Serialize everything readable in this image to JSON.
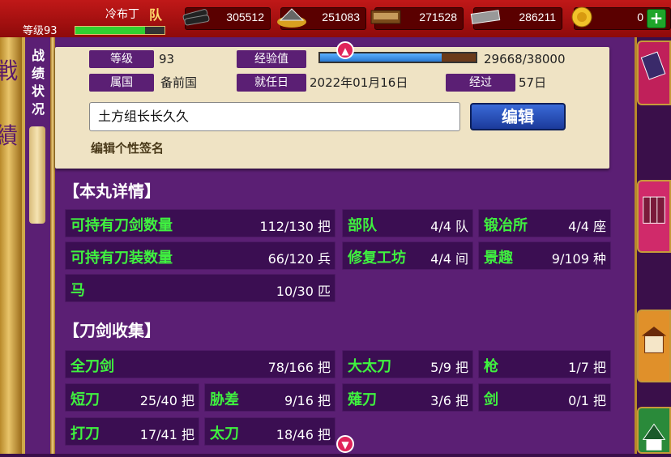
{
  "player": {
    "name": "冷布丁",
    "tag": "队",
    "level_label": "等级",
    "level": "93",
    "exp_fraction": 0.78
  },
  "resources": [
    {
      "name": "charcoal",
      "icon": "charcoal-icon",
      "value": "305512"
    },
    {
      "name": "steel",
      "icon": "steel-icon",
      "value": "251083"
    },
    {
      "name": "coolant",
      "icon": "coolant-icon",
      "value": "271528"
    },
    {
      "name": "whetstone",
      "icon": "whetstone-icon",
      "value": "286211"
    },
    {
      "name": "koban",
      "icon": "koban-icon",
      "value": "0"
    }
  ],
  "side": {
    "title_chars": [
      "战",
      "绩",
      "状",
      "况"
    ]
  },
  "profile": {
    "level_label": "等级",
    "level_value": "93",
    "exp_label": "经验值",
    "exp_value": "29668/38000",
    "exp_fraction": 0.781,
    "country_label": "属国",
    "country_value": "备前国",
    "appointed_label": "就任日",
    "appointed_value": "2022年01月16日",
    "elapsed_label": "经过",
    "elapsed_value": "57日",
    "signature": "土方组长长久久",
    "edit_label": "编辑",
    "signature_hint": "编辑个性签名"
  },
  "citadel": {
    "title": "【本丸详情】",
    "rows": [
      {
        "key": "可持有刀剑数量",
        "value": "112/130 把"
      },
      {
        "key": "部队",
        "value": "4/4 队"
      },
      {
        "key": "锻冶所",
        "value": "4/4 座"
      },
      {
        "key": "可持有刀装数量",
        "value": "66/120 兵"
      },
      {
        "key": "修复工坊",
        "value": "4/4 间"
      },
      {
        "key": "景趣",
        "value": "9/109 种"
      },
      {
        "key": "马",
        "value": "10/30 匹"
      }
    ]
  },
  "collection": {
    "title": "【刀剑收集】",
    "rows": [
      {
        "key": "全刀剑",
        "value": "78/166 把"
      },
      {
        "key": "大太刀",
        "value": "5/9 把"
      },
      {
        "key": "枪",
        "value": "1/7 把"
      },
      {
        "key": "短刀",
        "value": "25/40 把"
      },
      {
        "key": "胁差",
        "value": "9/16 把"
      },
      {
        "key": "薙刀",
        "value": "3/6 把"
      },
      {
        "key": "剑",
        "value": "0/1 把"
      },
      {
        "key": "打刀",
        "value": "17/41 把"
      },
      {
        "key": "太刀",
        "value": "18/46 把"
      }
    ]
  },
  "colors": {
    "panel": "#5b1f74",
    "cell": "#3b0e52",
    "key_text": "#3ff23f",
    "topbar": "#b01414"
  }
}
